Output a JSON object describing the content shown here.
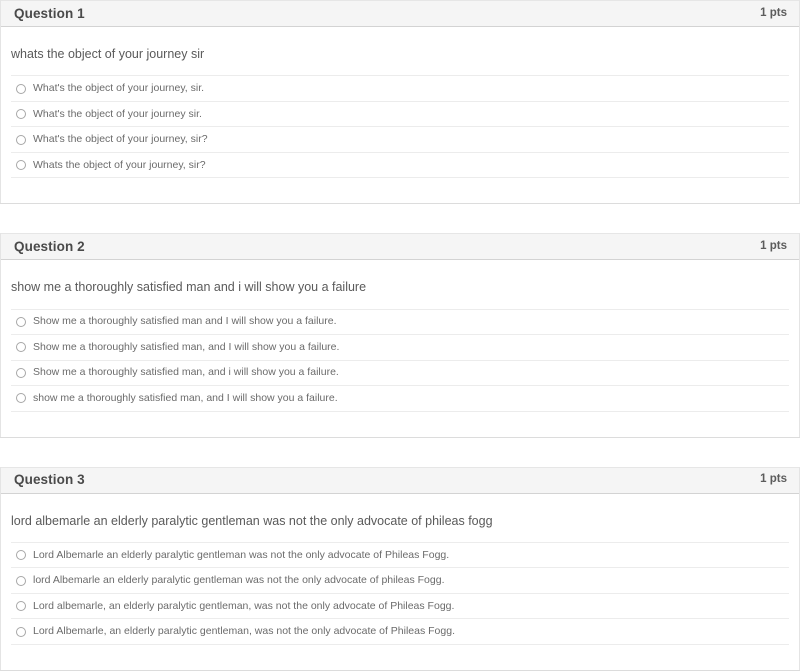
{
  "page": {
    "type": "quiz-attempt",
    "colors": {
      "header_band": "#f5f5f5",
      "header_border": "#d3d3d3",
      "card_border": "#dcdcdc",
      "separator": "#ececec",
      "title_text": "#4a4a4a",
      "stem_text": "#5a5a5a",
      "answer_text": "#6b6b6b",
      "radio_border": "#a7a7a7",
      "background": "#ffffff"
    }
  },
  "questions": [
    {
      "title": "Question 1",
      "points": "1 pts",
      "stem": "whats the object of your journey sir",
      "options": [
        {
          "label": "What's the object of your journey, sir.",
          "selected": false
        },
        {
          "label": "What's the object of your journey sir.",
          "selected": false
        },
        {
          "label": "What's the object of your journey, sir?",
          "selected": false
        },
        {
          "label": "Whats the object of your journey, sir?",
          "selected": false
        }
      ]
    },
    {
      "title": "Question 2",
      "points": "1 pts",
      "stem": "show me a thoroughly satisfied man and i will show you a failure",
      "options": [
        {
          "label": "Show me a thoroughly satisfied man and I will show you a failure.",
          "selected": false
        },
        {
          "label": "Show me a thoroughly satisfied man, and I will show you a failure.",
          "selected": false
        },
        {
          "label": "Show me a thoroughly satisfied man, and i will show you a failure.",
          "selected": false
        },
        {
          "label": "show me a thoroughly satisfied man, and I will show you a failure.",
          "selected": false
        }
      ]
    },
    {
      "title": "Question 3",
      "points": "1 pts",
      "stem": "lord albemarle an elderly paralytic gentleman was not the only advocate of phileas fogg",
      "options": [
        {
          "label": "Lord Albemarle an elderly paralytic gentleman was not the only advocate of Phileas Fogg.",
          "selected": false
        },
        {
          "label": "lord Albemarle an elderly paralytic gentleman was not the only advocate of phileas Fogg.",
          "selected": false
        },
        {
          "label": "Lord albemarle, an elderly paralytic gentleman, was not the only advocate of Phileas Fogg.",
          "selected": false
        },
        {
          "label": "Lord Albemarle, an elderly paralytic gentleman, was not the only advocate of Phileas Fogg.",
          "selected": false
        }
      ]
    }
  ]
}
